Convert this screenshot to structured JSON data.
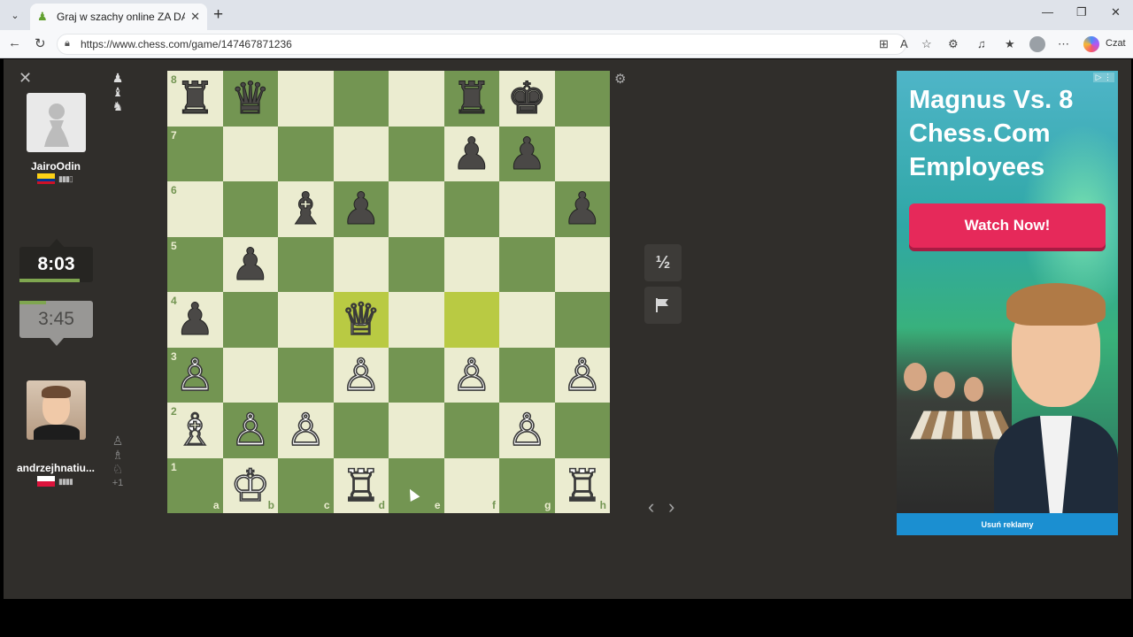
{
  "browser": {
    "tab_title": "Graj w szachy online ZA DARMO -",
    "url": "https://www.chess.com/game/147467871236",
    "copilot_label": "Czat"
  },
  "players": {
    "top": {
      "name": "JairoOdin",
      "country": "Colombia",
      "clock": "8:03",
      "clock_active": true
    },
    "bottom": {
      "name": "andrzejhnatiu...",
      "country": "Poland",
      "clock": "3:45",
      "clock_active": false,
      "material_advantage": "+1"
    }
  },
  "controls": {
    "draw_label": "½"
  },
  "board": {
    "ranks": [
      "8",
      "7",
      "6",
      "5",
      "4",
      "3",
      "2",
      "1"
    ],
    "files": [
      "a",
      "b",
      "c",
      "d",
      "e",
      "f",
      "g",
      "h"
    ],
    "highlight": [
      "d4",
      "f4"
    ],
    "pieces": [
      {
        "sq": "a8",
        "t": "rook",
        "c": "b"
      },
      {
        "sq": "b8",
        "t": "queen",
        "c": "b"
      },
      {
        "sq": "f8",
        "t": "rook",
        "c": "b"
      },
      {
        "sq": "g8",
        "t": "king",
        "c": "b"
      },
      {
        "sq": "f7",
        "t": "pawn",
        "c": "b"
      },
      {
        "sq": "g7",
        "t": "pawn",
        "c": "b"
      },
      {
        "sq": "c6",
        "t": "bishop",
        "c": "b"
      },
      {
        "sq": "d6",
        "t": "pawn",
        "c": "b"
      },
      {
        "sq": "h6",
        "t": "pawn",
        "c": "b"
      },
      {
        "sq": "b5",
        "t": "pawn",
        "c": "b"
      },
      {
        "sq": "a4",
        "t": "pawn",
        "c": "b"
      },
      {
        "sq": "d4",
        "t": "queen",
        "c": "w"
      },
      {
        "sq": "a3",
        "t": "pawn",
        "c": "w"
      },
      {
        "sq": "d3",
        "t": "pawn",
        "c": "w"
      },
      {
        "sq": "f3",
        "t": "pawn",
        "c": "w"
      },
      {
        "sq": "h3",
        "t": "pawn",
        "c": "w"
      },
      {
        "sq": "a2",
        "t": "bishop",
        "c": "w"
      },
      {
        "sq": "b2",
        "t": "pawn",
        "c": "w"
      },
      {
        "sq": "c2",
        "t": "pawn",
        "c": "w"
      },
      {
        "sq": "g2",
        "t": "pawn",
        "c": "w"
      },
      {
        "sq": "b1",
        "t": "king",
        "c": "w"
      },
      {
        "sq": "d1",
        "t": "rook",
        "c": "w"
      },
      {
        "sq": "h1",
        "t": "rook",
        "c": "w"
      }
    ]
  },
  "ad": {
    "headline": "Magnus Vs. 8 Chess.Com Employees",
    "cta": "Watch Now!",
    "remove_ads": "Usuń reklamy"
  },
  "colors": {
    "light_square": "#ebecd0",
    "dark_square": "#739552",
    "highlight_light": "#f5f682",
    "highlight_dark": "#b9ca43",
    "ad_button": "#e6295a",
    "ad_footer": "#1b8fd1"
  }
}
